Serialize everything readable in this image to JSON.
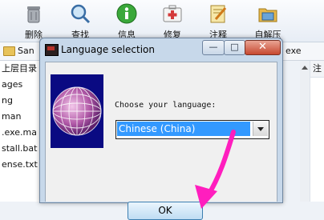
{
  "toolbar": {
    "items": [
      {
        "label": "删除",
        "icon": "delete-icon"
      },
      {
        "label": "查找",
        "icon": "search-icon"
      },
      {
        "label": "信息",
        "icon": "info-icon"
      },
      {
        "label": "修复",
        "icon": "first-aid-icon"
      },
      {
        "label": "注释",
        "icon": "comment-icon"
      },
      {
        "label": "自解压",
        "icon": "self-extract-icon"
      }
    ]
  },
  "pathbar": {
    "path": "San",
    "right_text": "exe"
  },
  "filelist": {
    "items": [
      "上层目录",
      "ages",
      "ng",
      "man",
      ".exe.ma",
      "stall.bat",
      "ense.txt"
    ]
  },
  "rightcol": {
    "header": "注"
  },
  "dialog": {
    "title": "Language selection",
    "min_label": "—",
    "max_label": "□",
    "close_label": "✕",
    "prompt": "Choose your language:",
    "language_value": "Chinese (China)",
    "ok_label": "OK"
  },
  "colors": {
    "selection": "#3399ff",
    "globe_bg": "#0a0a82",
    "pointer": "#ff1ebe"
  }
}
